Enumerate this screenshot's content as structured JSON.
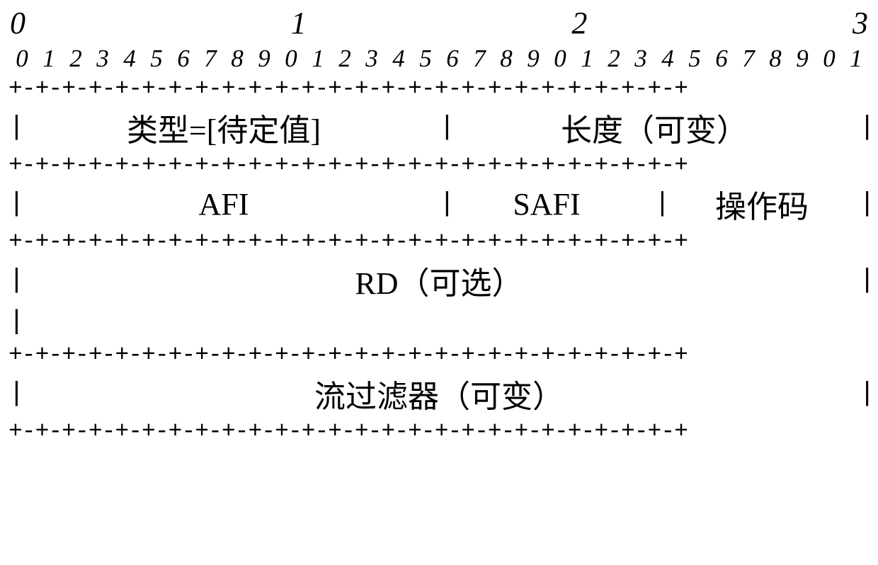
{
  "chart_data": {
    "type": "table",
    "description": "Protocol packet bit-field layout (32 bits wide)",
    "bit_width": 32,
    "byte_markers": [
      "0",
      "1",
      "2",
      "3"
    ],
    "bit_ruler": [
      "0",
      "1",
      "2",
      "3",
      "4",
      "5",
      "6",
      "7",
      "8",
      "9",
      "0",
      "1",
      "2",
      "3",
      "4",
      "5",
      "6",
      "7",
      "8",
      "9",
      "0",
      "1",
      "2",
      "3",
      "4",
      "5",
      "6",
      "7",
      "8",
      "9",
      "0",
      "1"
    ],
    "divider": "+-+-+-+-+-+-+-+-+-+-+-+-+-+-+-+-+-+-+-+-+-+-+-+-+-+",
    "rows": [
      {
        "cells": [
          {
            "text": "类型=[待定值]",
            "bits": 16
          },
          {
            "text": "长度（可变）",
            "bits": 16
          }
        ]
      },
      {
        "cells": [
          {
            "text": "AFI",
            "bits": 16
          },
          {
            "text": "SAFI",
            "bits": 8
          },
          {
            "text": "操作码",
            "bits": 8
          }
        ]
      },
      {
        "cells": [
          {
            "text": "RD（可选）",
            "bits": 32
          }
        ],
        "open_continuation": true
      },
      {
        "cells": [
          {
            "text": "流过滤器（可变）",
            "bits": 32
          }
        ]
      }
    ]
  }
}
